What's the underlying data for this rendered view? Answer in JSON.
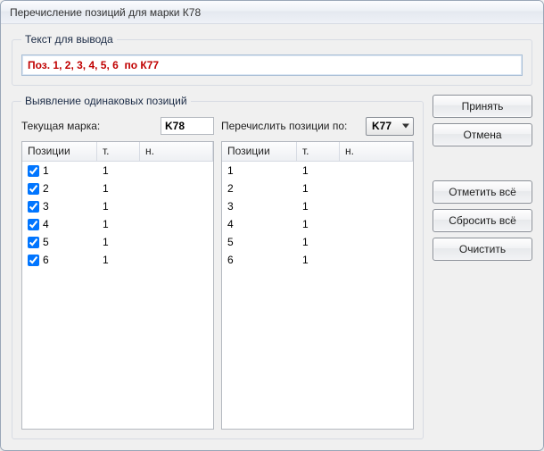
{
  "window": {
    "title": "Перечисление позиций для марки К78"
  },
  "output_group": {
    "legend": "Текст для вывода",
    "value": "Поз. 1, 2, 3, 4, 5, 6  по К77"
  },
  "dup_group": {
    "legend": "Выявление одинаковых позиций",
    "current_mark_label": "Текущая марка:",
    "current_mark_value": "K78",
    "list_by_label": "Перечислить позиции по:",
    "list_by_value": "K77",
    "columns": {
      "pos": "Позиции",
      "t": "т.",
      "n": "н."
    },
    "left_rows": [
      {
        "checked": true,
        "pos": "1",
        "t": "1",
        "n": ""
      },
      {
        "checked": true,
        "pos": "2",
        "t": "1",
        "n": ""
      },
      {
        "checked": true,
        "pos": "3",
        "t": "1",
        "n": ""
      },
      {
        "checked": true,
        "pos": "4",
        "t": "1",
        "n": ""
      },
      {
        "checked": true,
        "pos": "5",
        "t": "1",
        "n": ""
      },
      {
        "checked": true,
        "pos": "6",
        "t": "1",
        "n": ""
      }
    ],
    "right_rows": [
      {
        "pos": "1",
        "t": "1",
        "n": ""
      },
      {
        "pos": "2",
        "t": "1",
        "n": ""
      },
      {
        "pos": "3",
        "t": "1",
        "n": ""
      },
      {
        "pos": "4",
        "t": "1",
        "n": ""
      },
      {
        "pos": "5",
        "t": "1",
        "n": ""
      },
      {
        "pos": "6",
        "t": "1",
        "n": ""
      }
    ]
  },
  "buttons": {
    "accept": "Принять",
    "cancel": "Отмена",
    "check_all": "Отметить всё",
    "uncheck_all": "Сбросить всё",
    "clear": "Очистить"
  }
}
